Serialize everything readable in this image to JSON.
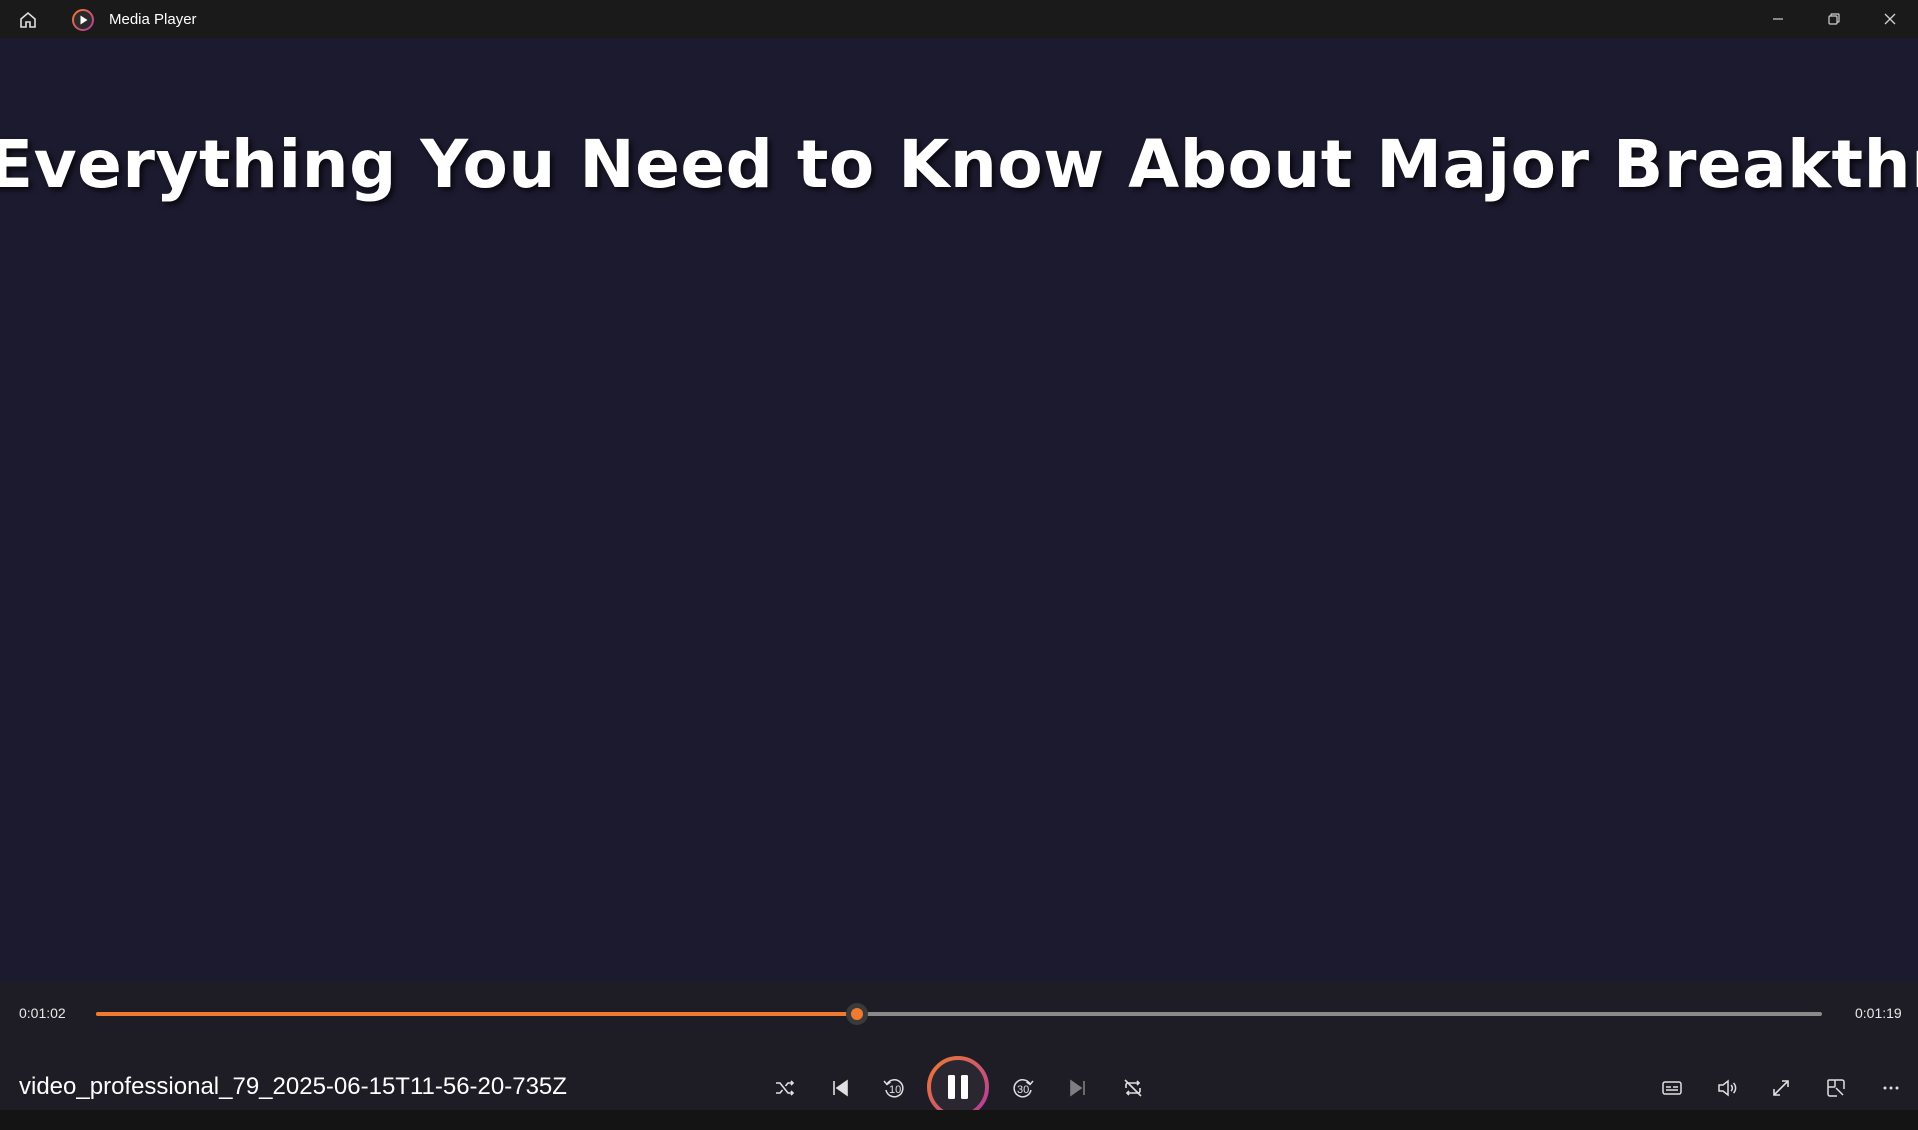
{
  "window": {
    "title": "Media Player",
    "icons": [
      "home-icon",
      "app-logo-icon",
      "minimize-icon",
      "restore-icon",
      "close-icon"
    ]
  },
  "video": {
    "overlay_text": "Everything You Need to Know About Major Breakthrou"
  },
  "playback": {
    "current_time": "0:01:02",
    "total_time": "0:01:19",
    "progress_fraction": 0.441,
    "state": "playing",
    "filename": "video_professional_79_2025-06-15T11-56-20-735Z"
  },
  "controls": {
    "center_icons": [
      "shuffle-icon",
      "previous-icon",
      "skip-back-10-icon",
      "pause-icon",
      "skip-forward-30-icon",
      "next-icon",
      "repeat-off-icon"
    ],
    "skip_back_label": "10",
    "skip_forward_label": "30",
    "right_icons": [
      "captions-icon",
      "volume-icon",
      "fullscreen-icon",
      "mini-player-icon",
      "more-options-icon"
    ]
  },
  "colors": {
    "accent": "#f07a30",
    "accent_gradient_end": "#b03aa0",
    "video_bg": "#1c1a2e",
    "titlebar_bg": "#1a1a1a",
    "controls_bg": "#1e1d26"
  }
}
